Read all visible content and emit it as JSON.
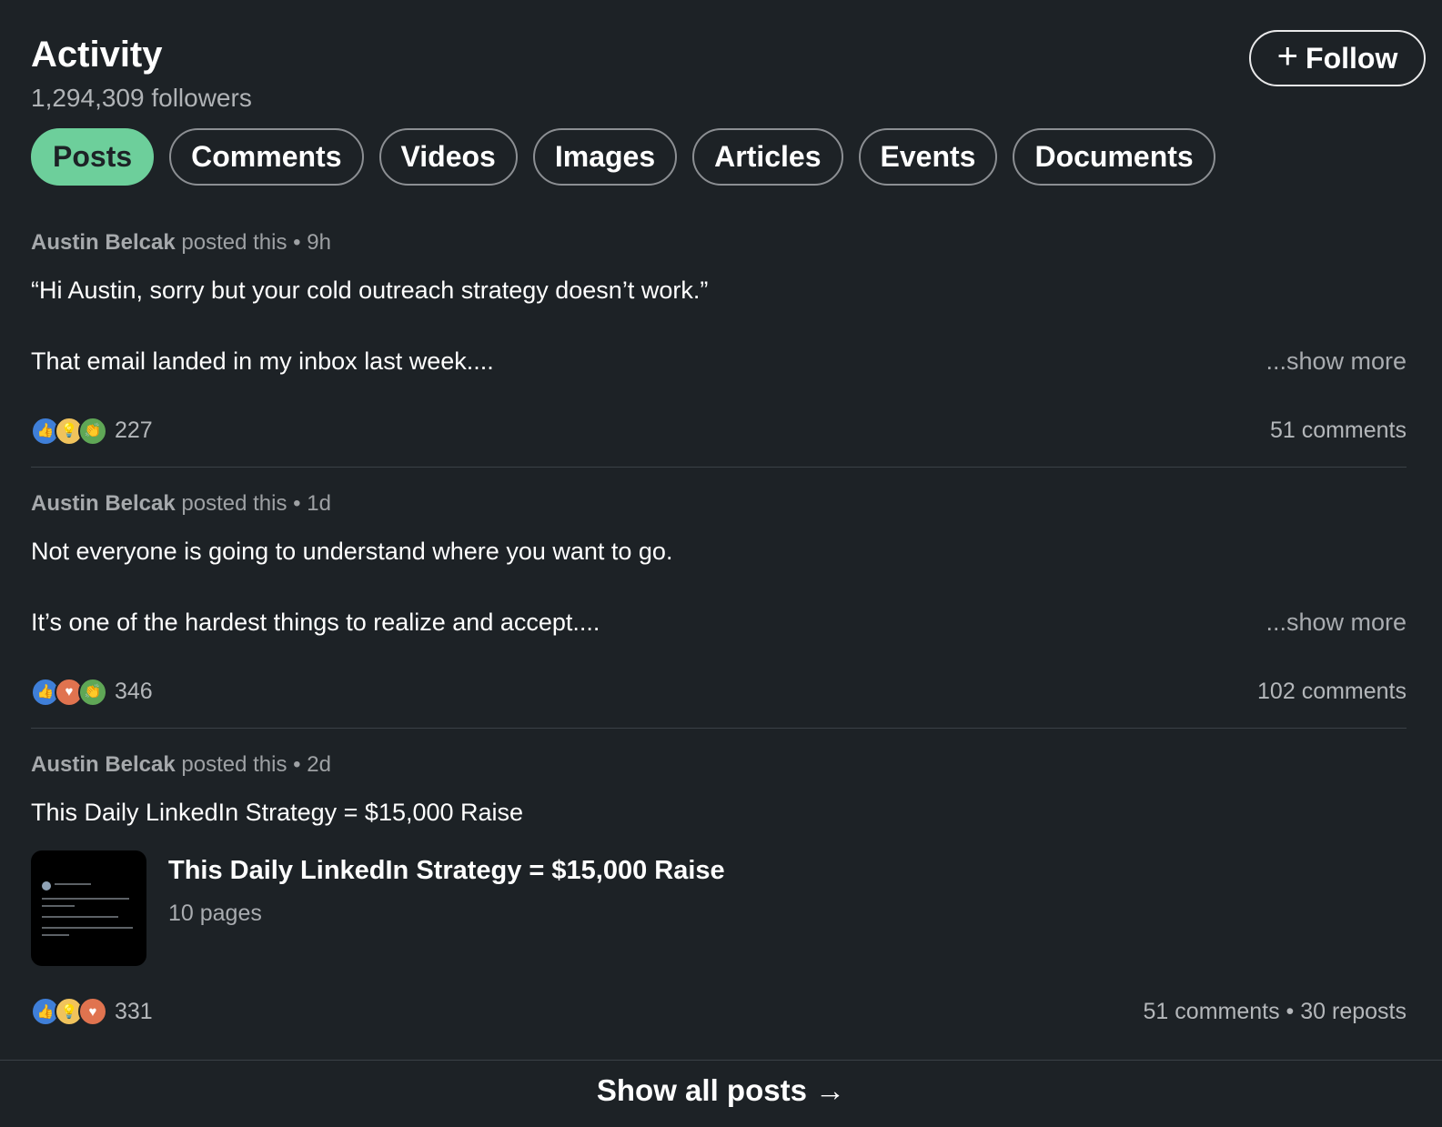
{
  "header": {
    "title": "Activity",
    "followers": "1,294,309 followers",
    "follow_label": "Follow"
  },
  "tabs": [
    {
      "label": "Posts",
      "active": true
    },
    {
      "label": "Comments",
      "active": false
    },
    {
      "label": "Videos",
      "active": false
    },
    {
      "label": "Images",
      "active": false
    },
    {
      "label": "Articles",
      "active": false
    },
    {
      "label": "Events",
      "active": false
    },
    {
      "label": "Documents",
      "active": false
    }
  ],
  "posts": [
    {
      "author": "Austin Belcak",
      "action": " posted this",
      "time": "9h",
      "line1": "“Hi Austin, sorry but your cold outreach strategy doesn’t work.”",
      "line2": "That email landed in my inbox last week....",
      "show_more": "...show more",
      "reactions": [
        "like",
        "insight",
        "celebrate"
      ],
      "reaction_count": "227",
      "comments": "51 comments"
    },
    {
      "author": "Austin Belcak",
      "action": " posted this",
      "time": "1d",
      "line1": "Not everyone is going to understand where you want to go.",
      "line2": "It’s one of the hardest things to realize and accept....",
      "show_more": "...show more",
      "reactions": [
        "like",
        "love",
        "celebrate"
      ],
      "reaction_count": "346",
      "comments": "102 comments"
    },
    {
      "author": "Austin Belcak",
      "action": " posted this",
      "time": "2d",
      "line1": "This Daily LinkedIn Strategy = $15,000 Raise",
      "doc_title": "This Daily LinkedIn Strategy = $15,000 Raise",
      "doc_pages": "10 pages",
      "reactions": [
        "like",
        "insight",
        "love"
      ],
      "reaction_count": "331",
      "comments": "51 comments",
      "reposts": "30 reposts"
    }
  ],
  "footer": {
    "show_all": "Show all posts →"
  },
  "colors": {
    "background": "#1d2226",
    "active_tab": "#6dcf9b"
  }
}
